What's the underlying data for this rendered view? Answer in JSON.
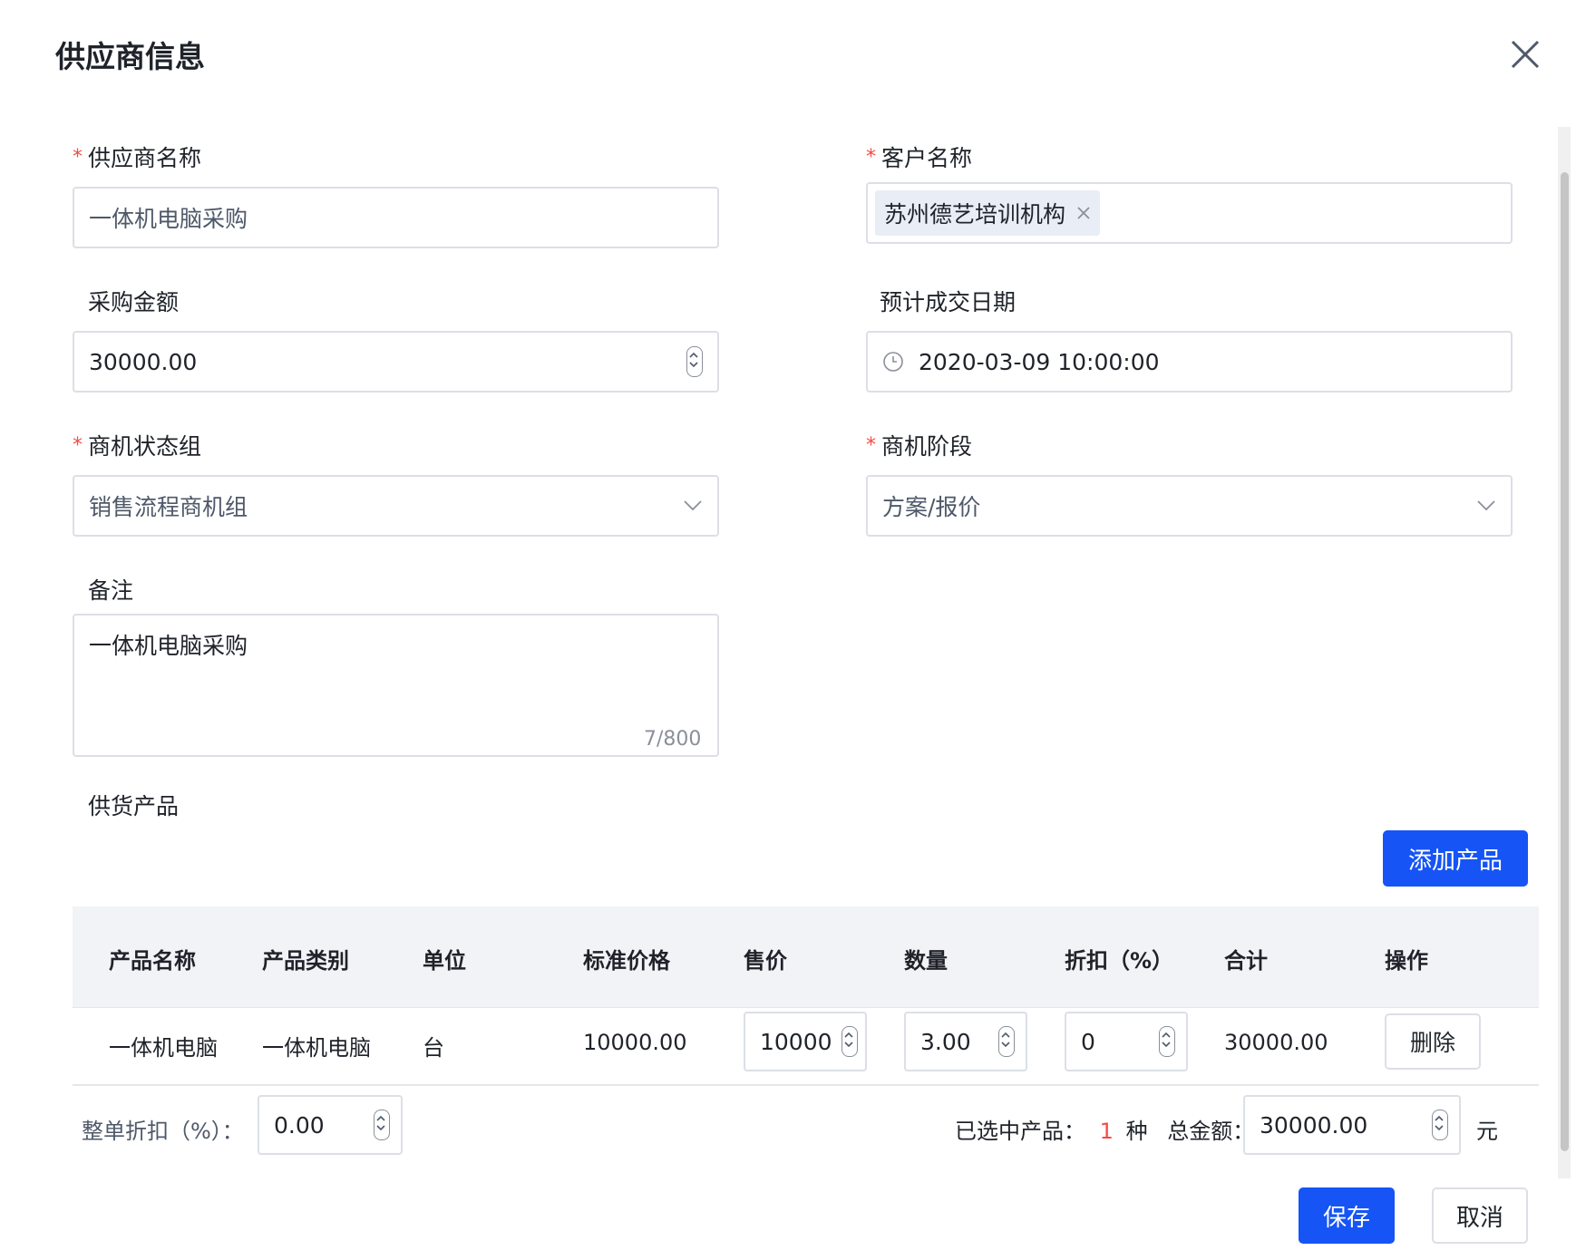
{
  "dialog": {
    "title": "供应商信息"
  },
  "form": {
    "supplier_name": {
      "label": "供应商名称",
      "required": true,
      "value": "一体机电脑采购"
    },
    "customer_name": {
      "label": "客户名称",
      "required": true,
      "tag": "苏州德艺培训机构"
    },
    "purchase_amount": {
      "label": "采购金额",
      "value": "30000.00"
    },
    "deal_date": {
      "label": "预计成交日期",
      "value": "2020-03-09 10:00:00"
    },
    "status_group": {
      "label": "商机状态组",
      "required": true,
      "value": "销售流程商机组"
    },
    "stage": {
      "label": "商机阶段",
      "required": true,
      "value": "方案/报价"
    },
    "note": {
      "label": "备注",
      "value": "一体机电脑采购",
      "counter": "7/800"
    },
    "products_label": "供货产品",
    "add_product_button": "添加产品"
  },
  "table": {
    "headers": [
      "产品名称",
      "产品类别",
      "单位",
      "标准价格",
      "售价",
      "数量",
      "折扣（%）",
      "合计",
      "操作"
    ],
    "rows": [
      {
        "name": "一体机电脑",
        "category": "一体机电脑",
        "unit": "台",
        "std_price": "10000.00",
        "sale_price": "10000",
        "quantity": "3.00",
        "discount": "0",
        "total": "30000.00",
        "action": "删除"
      }
    ]
  },
  "summary": {
    "order_discount_label": "整单折扣（%）：",
    "order_discount_value": "0.00",
    "selected_label": "已选中产品：",
    "selected_count": "1",
    "selected_unit": "种",
    "total_label": "总金额：",
    "total_value": "30000.00",
    "currency": "元"
  },
  "actions": {
    "save": "保存",
    "cancel": "取消"
  },
  "colors": {
    "primary": "#1654f5",
    "required": "#f54a45",
    "border": "#dcdfe6",
    "table_header_bg": "#f2f3f7"
  }
}
